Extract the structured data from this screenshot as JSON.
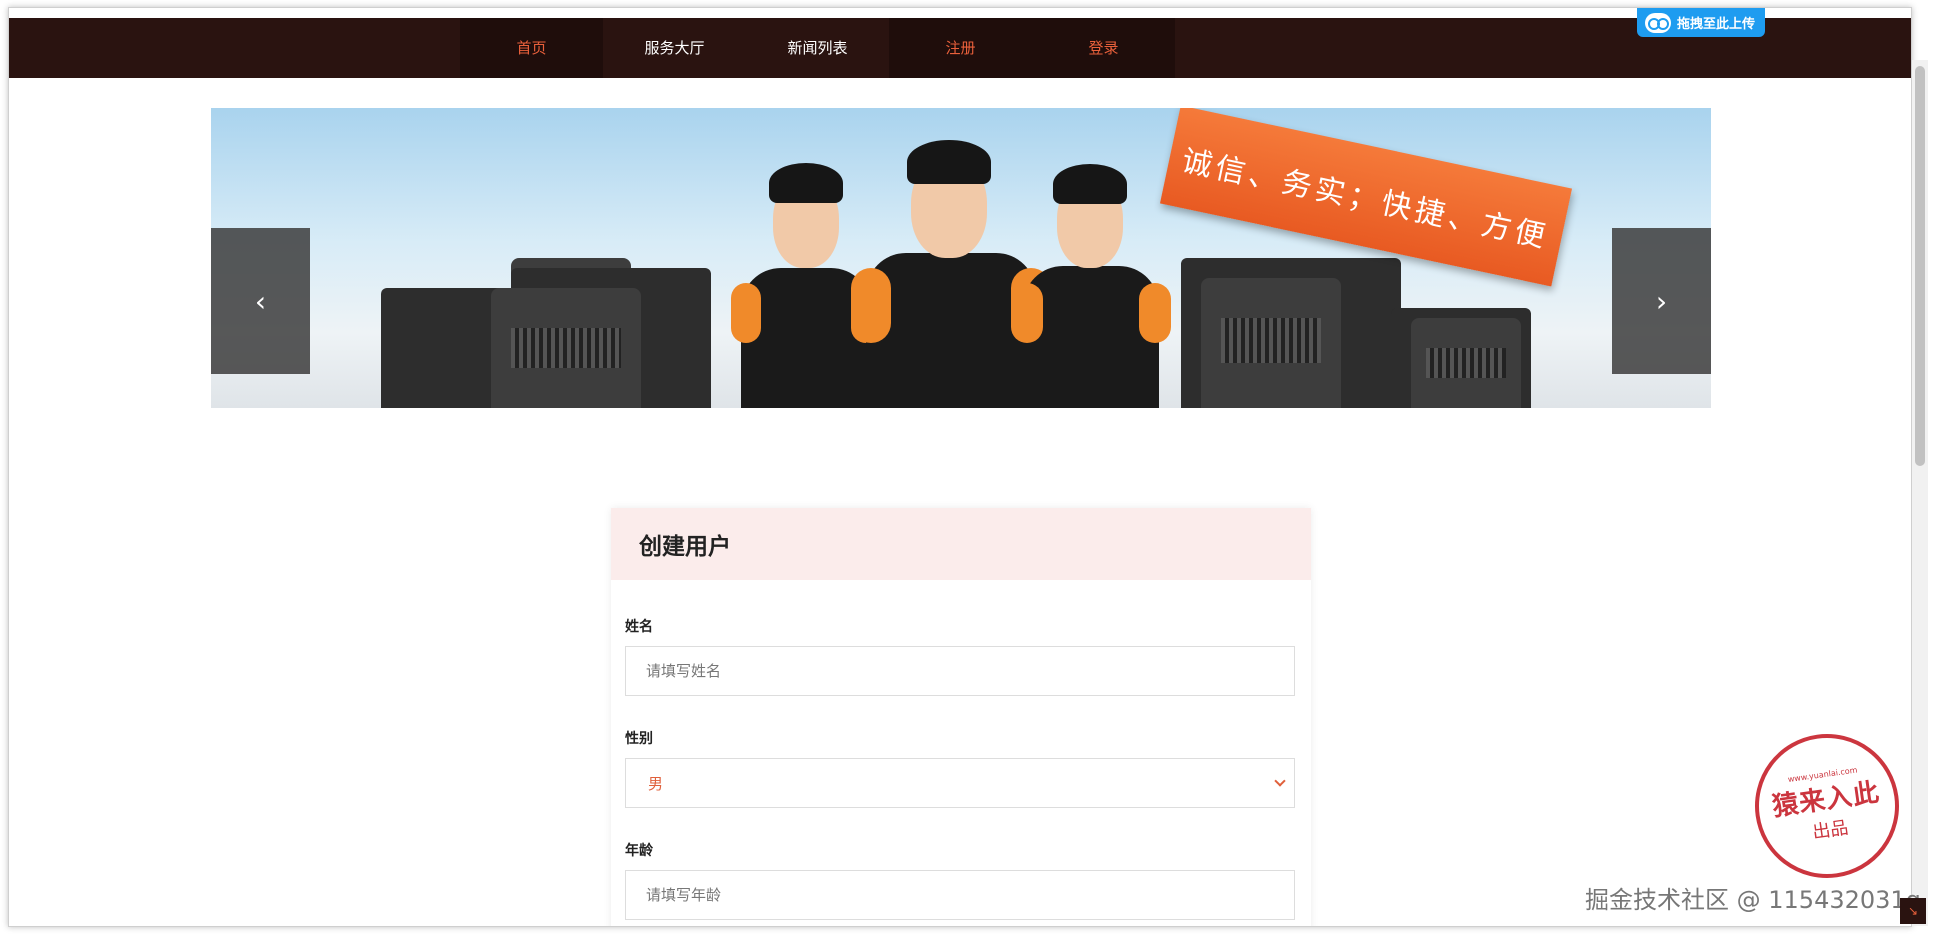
{
  "nav": {
    "items": [
      {
        "label": "首页"
      },
      {
        "label": "服务大厅"
      },
      {
        "label": "新闻列表"
      },
      {
        "label": "注册"
      },
      {
        "label": "登录"
      }
    ]
  },
  "upload": {
    "label": "拖拽至此上传"
  },
  "banner": {
    "slogan": "诚信、务实；快捷、方便",
    "prev_icon": "‹",
    "next_icon": "›"
  },
  "form": {
    "title": "创建用户",
    "name": {
      "label": "姓名",
      "placeholder": "请填写姓名"
    },
    "gender": {
      "label": "性别",
      "value": "男"
    },
    "age": {
      "label": "年龄",
      "placeholder": "请填写年龄"
    }
  },
  "stamp": {
    "url": "www.yuanlai.com",
    "main": "猿来入此",
    "sub": "出品"
  },
  "watermark": "掘金技术社区 @ 115432031q",
  "colors": {
    "nav_bg": "#2a1310",
    "accent": "#e9603b",
    "header_bg": "#fbeceb"
  }
}
